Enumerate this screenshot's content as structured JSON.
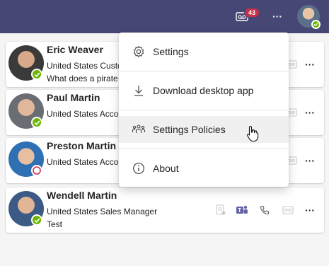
{
  "topbar": {
    "notification_count": "43",
    "more_label": "···",
    "accent": "#464775"
  },
  "menu": {
    "items": [
      {
        "label": "Settings",
        "icon": "gear-icon"
      },
      {
        "label": "Download desktop app",
        "icon": "download-icon"
      },
      {
        "label": "Settings Policies",
        "icon": "people-group-icon"
      },
      {
        "label": "About",
        "icon": "info-icon"
      }
    ]
  },
  "contacts": [
    {
      "name": "Eric Weaver",
      "line1": "United States Custo",
      "line2": "What does a pirate",
      "status": "available"
    },
    {
      "name": "Paul Martin",
      "line1": "United States Accou",
      "line2": "",
      "status": "available"
    },
    {
      "name": "Preston Martin",
      "line1": "United States Accou",
      "line2": "",
      "status": "away"
    },
    {
      "name": "Wendell Martin",
      "line1": "United States Sales Manager",
      "line2": "Test",
      "status": "available"
    }
  ],
  "card_more_label": "···"
}
